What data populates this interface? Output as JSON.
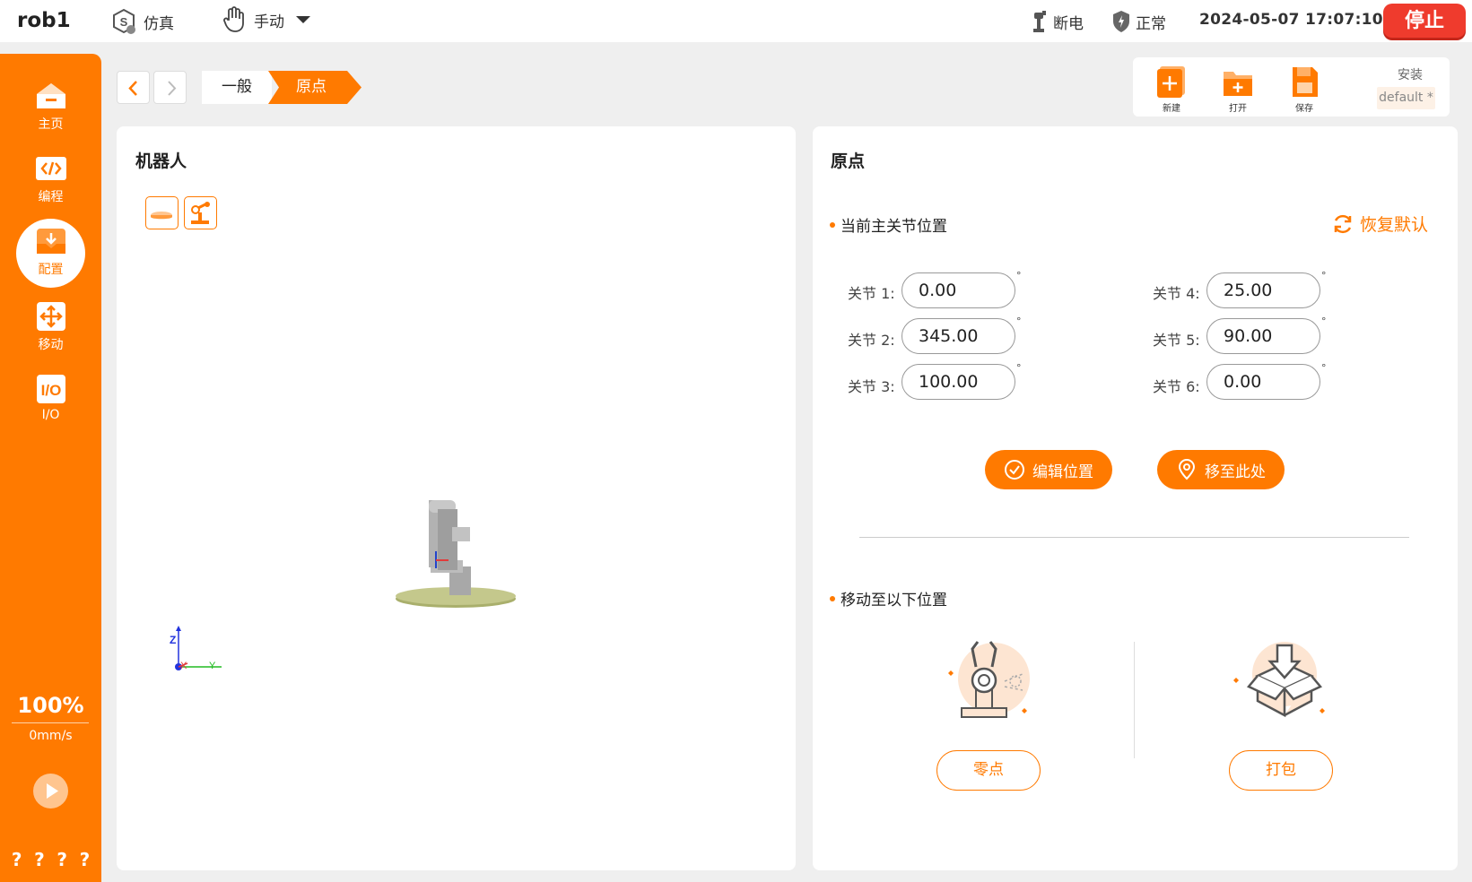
{
  "topbar": {
    "robot_name": "rob1",
    "mode_sim": "仿真",
    "mode_manual": "手动",
    "power_status": "断电",
    "safety_status": "正常",
    "datetime": "2024-05-07 17:07:10",
    "stop_label": "停止"
  },
  "sidebar": {
    "items": [
      {
        "label": "主页",
        "icon": "home-icon"
      },
      {
        "label": "编程",
        "icon": "code-icon"
      },
      {
        "label": "配置",
        "icon": "download-icon",
        "active": true
      },
      {
        "label": "移动",
        "icon": "move-icon"
      },
      {
        "label": "I/O",
        "icon": "io-icon"
      }
    ],
    "speed_percent": "100%",
    "speed_value": "0mm/s",
    "help_marks": [
      "?",
      "?",
      "?",
      "?"
    ]
  },
  "breadcrumb": {
    "items": [
      "一般",
      "原点"
    ]
  },
  "toolbar": {
    "new_label": "新建",
    "open_label": "打开",
    "save_label": "保存",
    "install_label": "安装",
    "install_value": "default *"
  },
  "left_panel": {
    "title": "机器人",
    "axis_labels": {
      "z": "Z",
      "x": "X",
      "y": "Y"
    }
  },
  "right_panel": {
    "title": "原点",
    "current_section": "当前主关节位置",
    "restore_label": "恢复默认",
    "joints": [
      {
        "label": "关节 1:",
        "value": "0.00"
      },
      {
        "label": "关节 2:",
        "value": "345.00"
      },
      {
        "label": "关节 3:",
        "value": "100.00"
      },
      {
        "label": "关节 4:",
        "value": "25.00"
      },
      {
        "label": "关节 5:",
        "value": "90.00"
      },
      {
        "label": "关节 6:",
        "value": "0.00"
      }
    ],
    "degree_symbol": "°",
    "edit_position_label": "编辑位置",
    "move_here_label": "移至此处",
    "move_section": "移动至以下位置",
    "zero_label": "零点",
    "pack_label": "打包"
  },
  "colors": {
    "accent": "#ff7a00",
    "stop": "#ef3b2d",
    "background": "#efefef"
  }
}
